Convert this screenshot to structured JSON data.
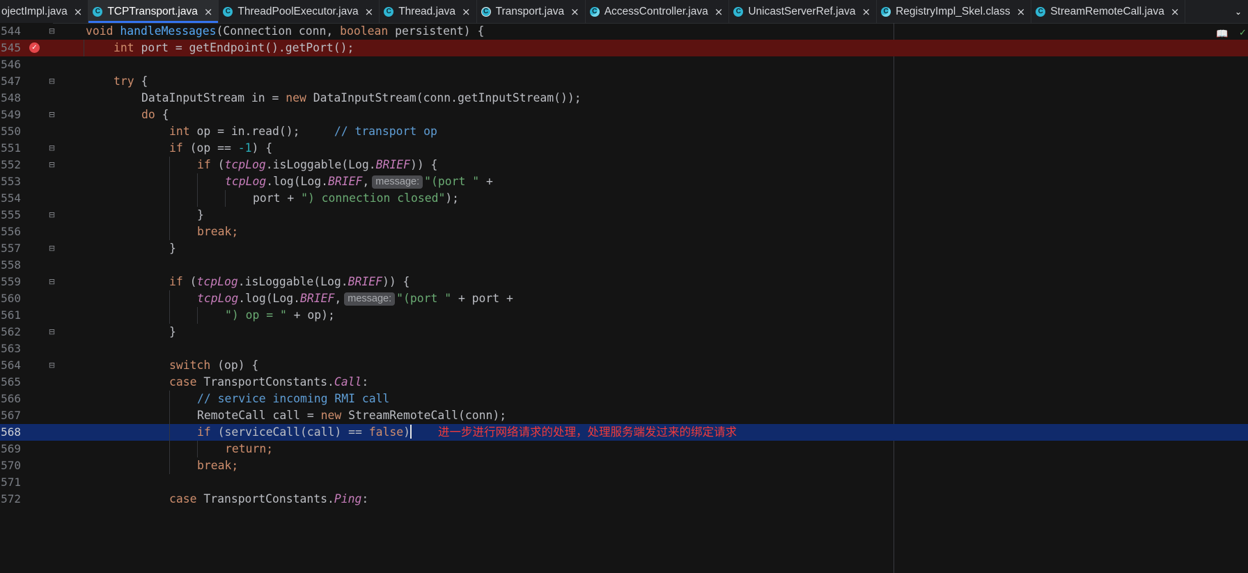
{
  "tabs": [
    {
      "label": "ojectImpl.java",
      "icon": "none",
      "active": false
    },
    {
      "label": "TCPTransport.java",
      "icon": "class",
      "active": true
    },
    {
      "label": "ThreadPoolExecutor.java",
      "icon": "class",
      "active": false
    },
    {
      "label": "Thread.java",
      "icon": "class",
      "active": false
    },
    {
      "label": "Transport.java",
      "icon": "class",
      "active": false
    },
    {
      "label": "AccessController.java",
      "icon": "class",
      "active": false
    },
    {
      "label": "UnicastServerRef.java",
      "icon": "class",
      "active": false
    },
    {
      "label": "RegistryImpl_Skel.class",
      "icon": "class",
      "active": false
    },
    {
      "label": "StreamRemoteCall.java",
      "icon": "class",
      "active": false
    }
  ],
  "tab_close_glyph": "×",
  "tab_overflow_glyph": "⌄",
  "hint_label": "message:",
  "annotation": "进一步进行网络请求的处理，处理服务端发过来的绑定请求",
  "lines": [
    {
      "n": "544"
    },
    {
      "n": "545"
    },
    {
      "n": "546"
    },
    {
      "n": "547"
    },
    {
      "n": "548"
    },
    {
      "n": "549"
    },
    {
      "n": "550"
    },
    {
      "n": "551"
    },
    {
      "n": "552"
    },
    {
      "n": "553"
    },
    {
      "n": "554"
    },
    {
      "n": "555"
    },
    {
      "n": "556"
    },
    {
      "n": "557"
    },
    {
      "n": "558"
    },
    {
      "n": "559"
    },
    {
      "n": "560"
    },
    {
      "n": "561"
    },
    {
      "n": "562"
    },
    {
      "n": "563"
    },
    {
      "n": "564"
    },
    {
      "n": "565"
    },
    {
      "n": "566"
    },
    {
      "n": "567"
    },
    {
      "n": "568"
    },
    {
      "n": "569"
    },
    {
      "n": "570"
    },
    {
      "n": "571"
    },
    {
      "n": "572"
    }
  ],
  "code": {
    "l544": [
      "void",
      " ",
      "handleMessages",
      "(Connection conn, ",
      "boolean",
      " persistent) {"
    ],
    "l545": [
      "int",
      " port = getEndpoint().getPort();"
    ],
    "l547": [
      "try",
      " {"
    ],
    "l548": [
      "DataInputStream in = ",
      "new",
      " DataInputStream(conn.getInputStream());"
    ],
    "l549": [
      "do",
      " {"
    ],
    "l550": [
      "int",
      " op = in.read();     ",
      "// transport op"
    ],
    "l551": [
      "if",
      " (op == ",
      "-1",
      ") {"
    ],
    "l552": [
      "if",
      " (",
      "tcpLog",
      ".isLoggable(Log.",
      "BRIEF",
      ")) {"
    ],
    "l553": [
      "tcpLog",
      ".log(Log.",
      "BRIEF",
      ",",
      "\"(port \"",
      " +"
    ],
    "l554": [
      "port + ",
      "\") connection closed\"",
      ");"
    ],
    "l555": [
      "}"
    ],
    "l556": [
      "break;"
    ],
    "l557": [
      "}"
    ],
    "l559": [
      "if",
      " (",
      "tcpLog",
      ".isLoggable(Log.",
      "BRIEF",
      ")) {"
    ],
    "l560": [
      "tcpLog",
      ".log(Log.",
      "BRIEF",
      ",",
      "\"(port \"",
      " + port +"
    ],
    "l561": [
      "\") op = \"",
      " + op);"
    ],
    "l562": [
      "}"
    ],
    "l564": [
      "switch",
      " (op) {"
    ],
    "l565": [
      "case",
      " TransportConstants.",
      "Call",
      ":"
    ],
    "l566": [
      "// service incoming RMI call"
    ],
    "l567": [
      "RemoteCall call = ",
      "new",
      " StreamRemoteCall(conn);"
    ],
    "l568": [
      "if",
      " (serviceCall(call) == ",
      "false",
      ")"
    ],
    "l569": [
      "return;"
    ],
    "l570": [
      "break;"
    ],
    "l572": [
      "case",
      " TransportConstants.",
      "Ping",
      ":"
    ]
  }
}
